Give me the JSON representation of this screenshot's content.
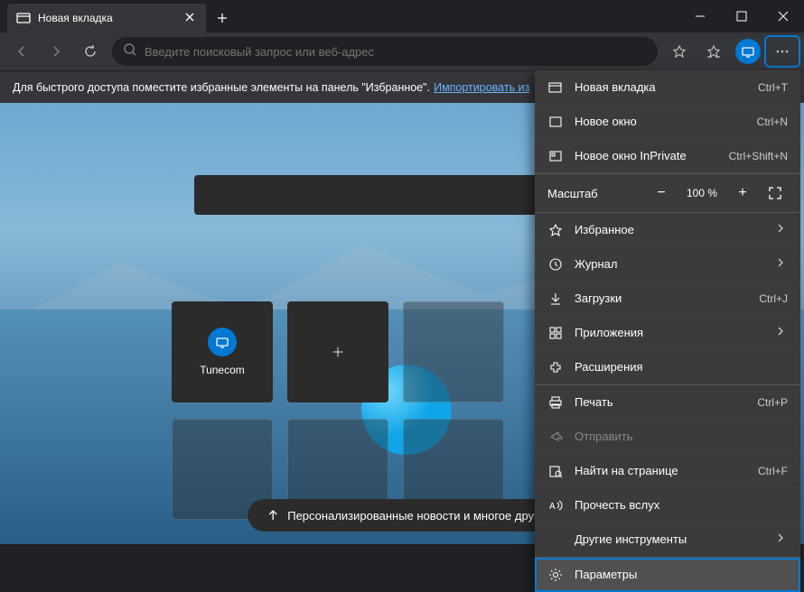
{
  "tab": {
    "title": "Новая вкладка"
  },
  "address_bar": {
    "placeholder": "Введите поисковый запрос или веб-адрес"
  },
  "infobar": {
    "text": "Для быстрого доступа поместите избранные элементы на панель \"Избранное\".",
    "link": "Импортировать из"
  },
  "tiles": {
    "items": [
      {
        "label": "Tunecom"
      }
    ]
  },
  "news_button": "Персонализированные новости и многое друг",
  "menu": {
    "new_tab": {
      "label": "Новая вкладка",
      "shortcut": "Ctrl+T"
    },
    "new_window": {
      "label": "Новое окно",
      "shortcut": "Ctrl+N"
    },
    "new_inprivate": {
      "label": "Новое окно InPrivate",
      "shortcut": "Ctrl+Shift+N"
    },
    "zoom": {
      "label": "Масштаб",
      "value": "100 %"
    },
    "favorites": {
      "label": "Избранное"
    },
    "history": {
      "label": "Журнал"
    },
    "downloads": {
      "label": "Загрузки",
      "shortcut": "Ctrl+J"
    },
    "apps": {
      "label": "Приложения"
    },
    "extensions": {
      "label": "Расширения"
    },
    "print": {
      "label": "Печать",
      "shortcut": "Ctrl+P"
    },
    "share": {
      "label": "Отправить"
    },
    "find": {
      "label": "Найти на странице",
      "shortcut": "Ctrl+F"
    },
    "read_aloud": {
      "label": "Прочесть вслух"
    },
    "more_tools": {
      "label": "Другие инструменты"
    },
    "settings": {
      "label": "Параметры"
    }
  }
}
